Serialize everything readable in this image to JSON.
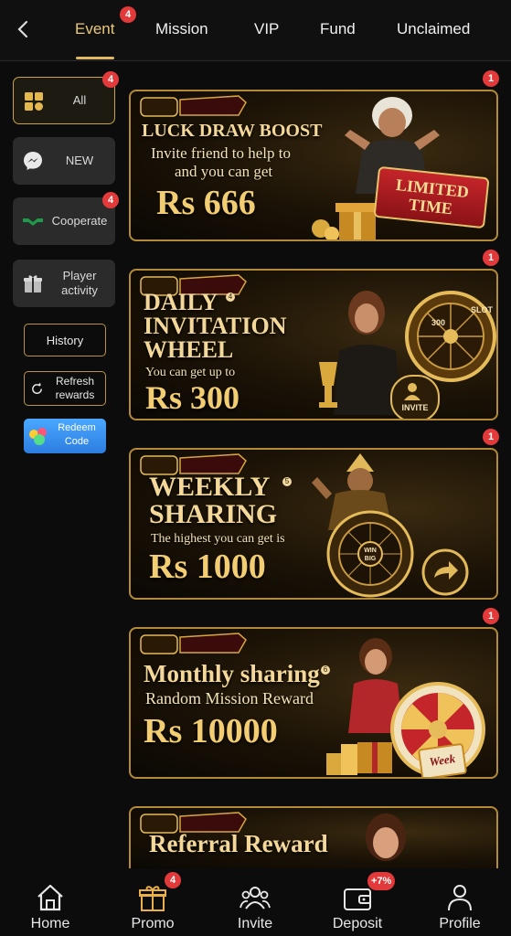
{
  "topnav": {
    "tabs": [
      {
        "label": "Event",
        "badge": "4"
      },
      {
        "label": "Mission"
      },
      {
        "label": "VIP"
      },
      {
        "label": "Fund"
      },
      {
        "label": "Unclaimed"
      }
    ],
    "accent": "#e2b95a"
  },
  "sidebar": {
    "items": [
      {
        "label": "All",
        "badge": "4",
        "icon": "grid-icon"
      },
      {
        "label": "NEW",
        "icon": "messenger-icon"
      },
      {
        "label": "Cooperate",
        "badge": "4",
        "icon": "handshake-icon"
      },
      {
        "label": "Player activity",
        "icon": "gift-icon"
      }
    ],
    "history_label": "History",
    "refresh_label": "Refresh rewards",
    "redeem_label": "Redeem Code"
  },
  "banners": [
    {
      "badge": "1",
      "logo": "ER666",
      "title": "LUCK DRAW BOOST",
      "line1": "Invite friend to help to",
      "line2": "and you can get",
      "amount": "Rs 666",
      "tag": "LIMITED TIME"
    },
    {
      "badge": "1",
      "logo": "ER666",
      "title1": "DAILY",
      "num": "4",
      "title2": "INVITATION",
      "title3": "WHEEL",
      "line1": "You can get up to",
      "amount": "Rs 300",
      "tag": "INVITE",
      "wheel1": "300",
      "wheel2": "SLOT"
    },
    {
      "badge": "1",
      "logo": "ER666",
      "title1": "WEEKLY",
      "num": "5",
      "title2": "SHARING",
      "line1": "The highest you can get is",
      "amount": "Rs 1000",
      "wheel": "WIN BIG"
    },
    {
      "badge": "1",
      "logo": "ER666",
      "title1": "Monthly sharing",
      "num": "6",
      "line1": "Random Mission Reward",
      "amount": "Rs 10000",
      "tag": "Week"
    },
    {
      "logo": "ER666",
      "title1": "Referral Reward"
    }
  ],
  "bottomnav": {
    "items": [
      {
        "label": "Home",
        "icon": "home-icon"
      },
      {
        "label": "Promo",
        "icon": "gift-icon",
        "badge": "4"
      },
      {
        "label": "Invite",
        "icon": "people-icon"
      },
      {
        "label": "Deposit",
        "icon": "wallet-icon",
        "badge": "+7%"
      },
      {
        "label": "Profile",
        "icon": "person-icon"
      }
    ]
  }
}
